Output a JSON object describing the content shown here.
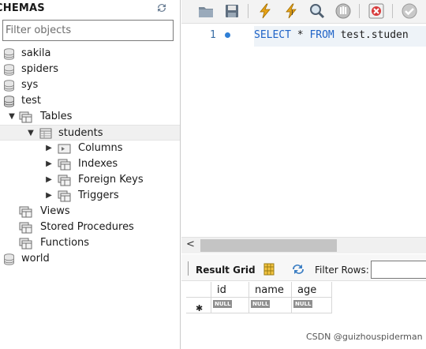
{
  "navigator": {
    "title": "CHEMAS",
    "filter_placeholder": "Filter objects",
    "schemas": [
      {
        "name": "sakila"
      },
      {
        "name": "spiders"
      },
      {
        "name": "sys"
      },
      {
        "name": "test"
      },
      {
        "name": "world"
      }
    ],
    "test_children": {
      "tables_label": "Tables",
      "students_label": "students",
      "students_children": [
        "Columns",
        "Indexes",
        "Foreign Keys",
        "Triggers"
      ],
      "views_label": "Views",
      "procedures_label": "Stored Procedures",
      "functions_label": "Functions"
    }
  },
  "editor": {
    "line_number": "1",
    "code_keyword1": "SELECT",
    "code_star": " * ",
    "code_keyword2": "FROM",
    "code_rest": " test.studen"
  },
  "result": {
    "result_grid_label": "Result Grid",
    "filter_rows_label": "Filter Rows:",
    "columns": [
      "id",
      "name",
      "age"
    ],
    "null_label": "NULL"
  },
  "watermark": "CSDN @guizhouspiderman",
  "colors": {
    "keyword": "#1f63c7",
    "selection_row": "#f0f0f0",
    "accent_dot": "#2f7fd6"
  }
}
